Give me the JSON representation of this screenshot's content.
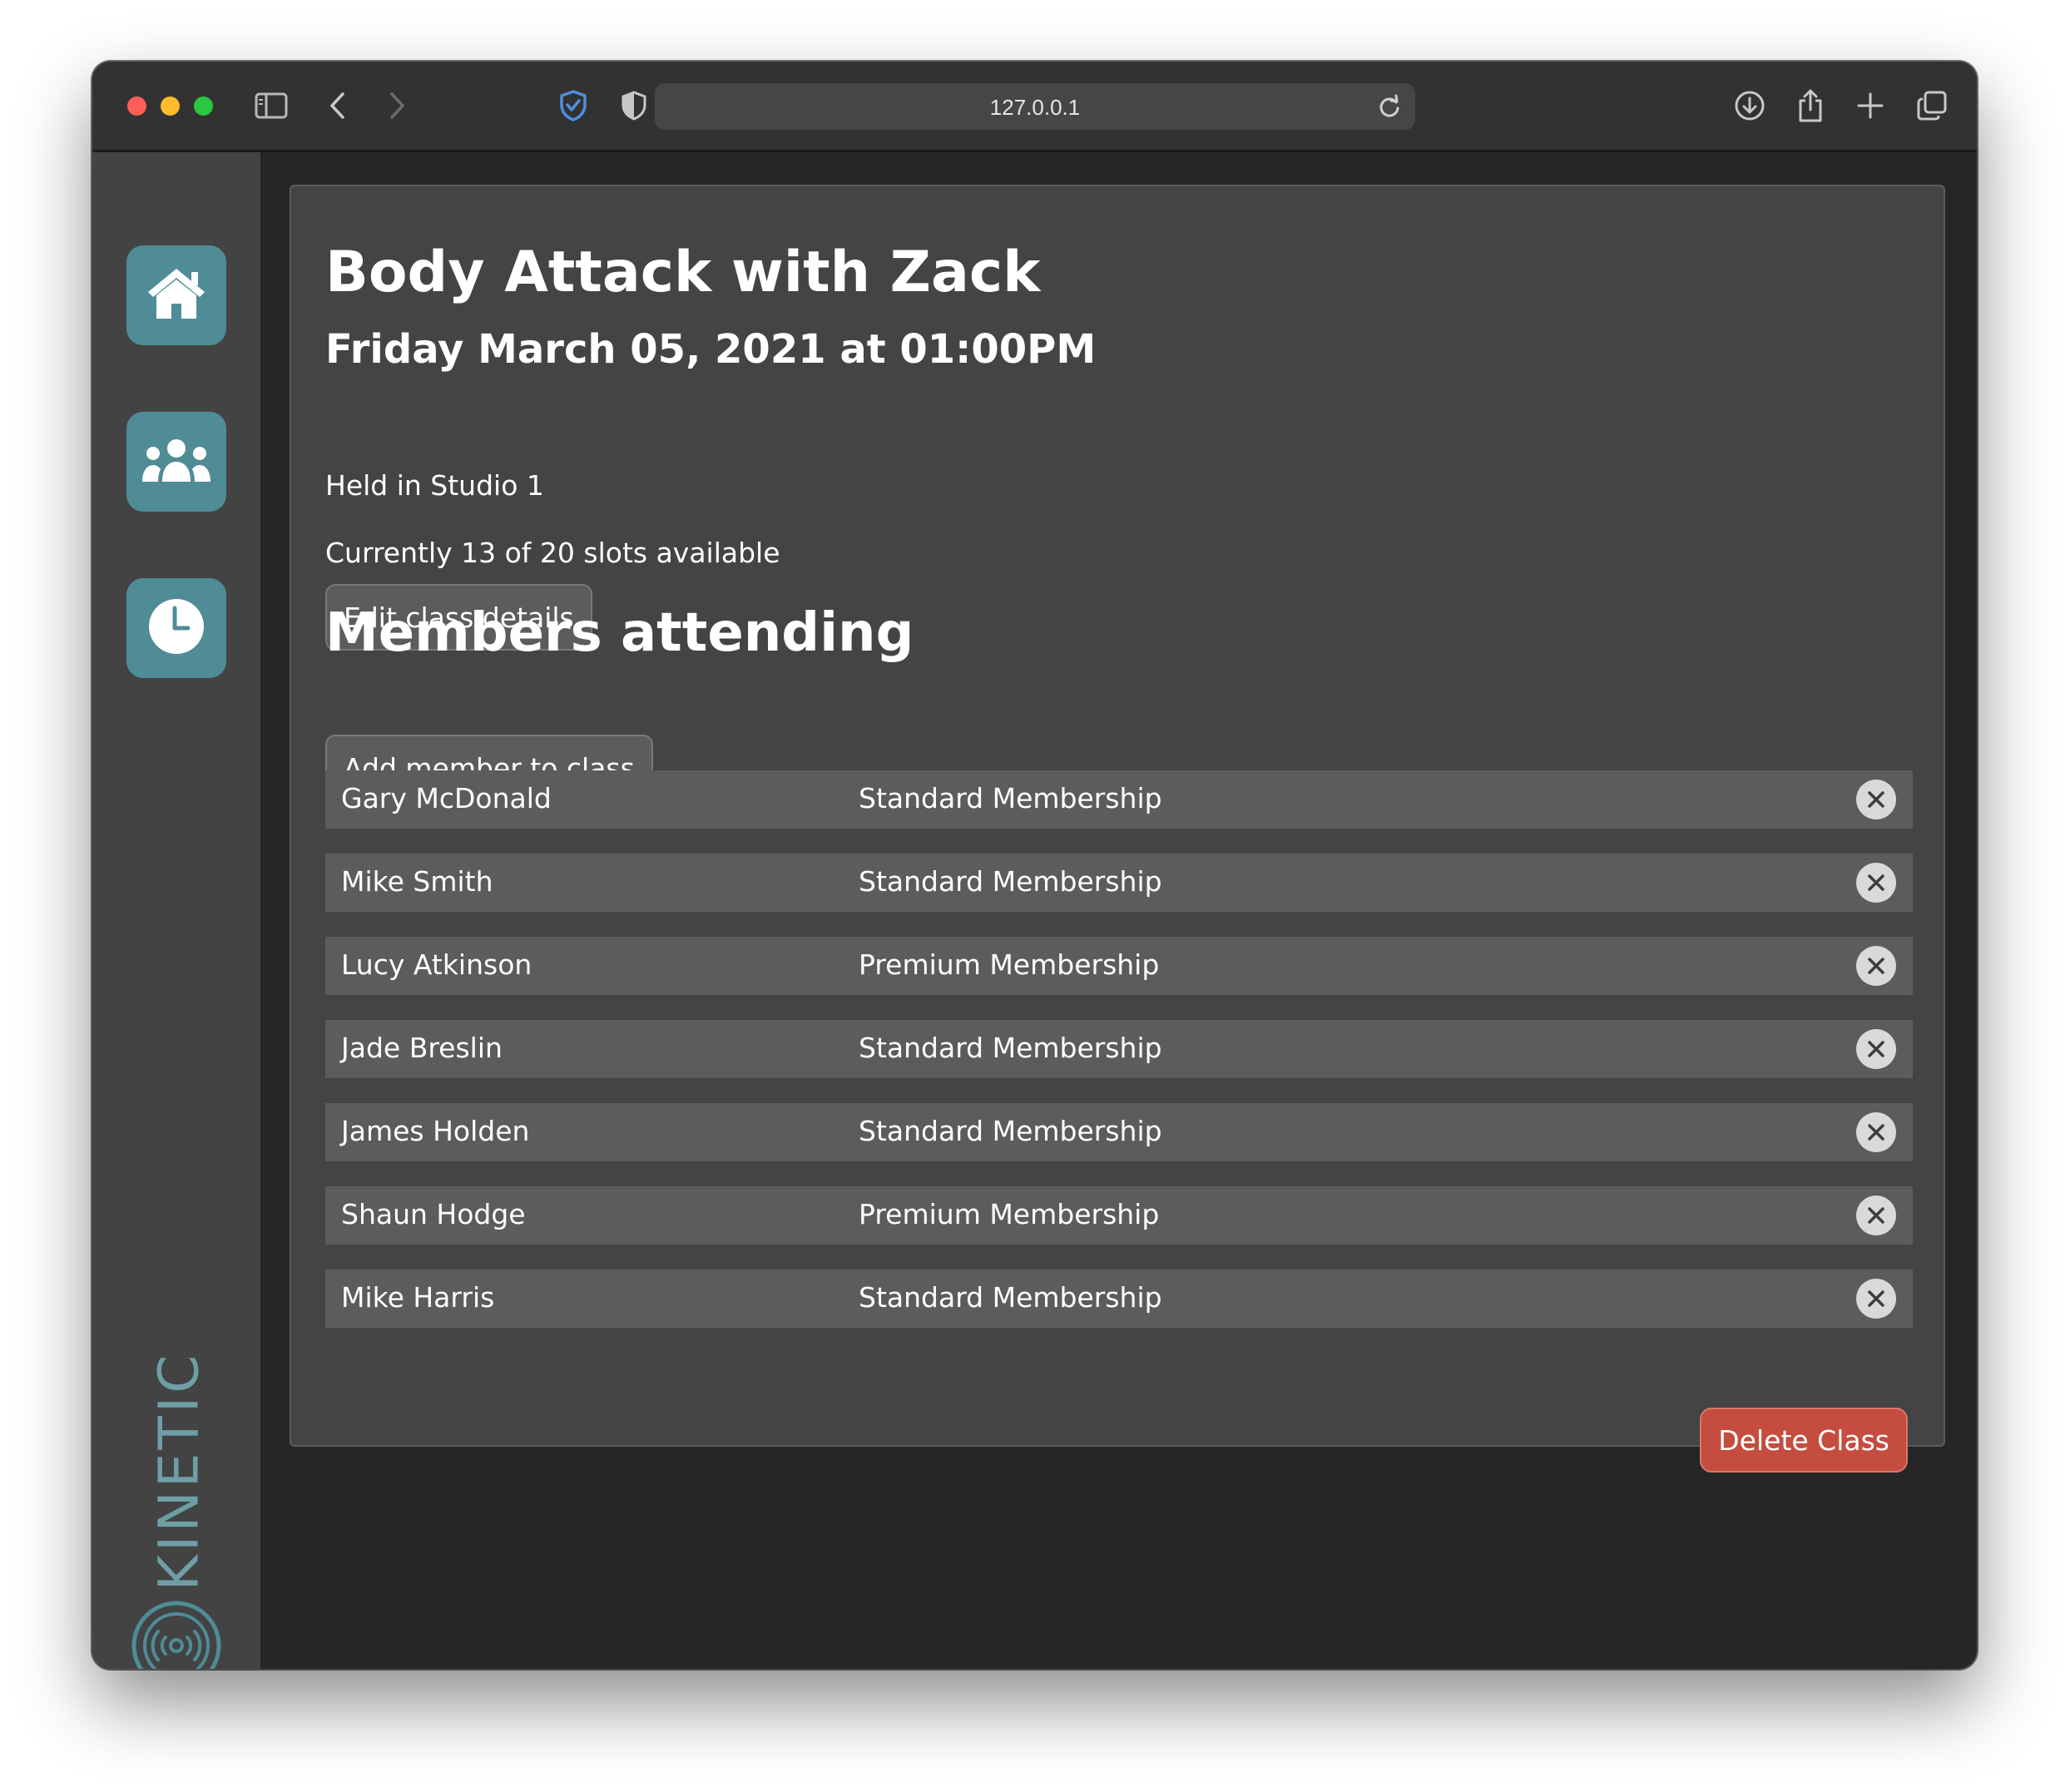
{
  "browser": {
    "url": "127.0.0.1",
    "traffic_colors": {
      "close": "#ff5f57",
      "minimize": "#febc2e",
      "zoom": "#28c840"
    }
  },
  "sidebar": {
    "brand": "KINETIC",
    "nav": [
      {
        "icon": "home-icon"
      },
      {
        "icon": "members-icon"
      },
      {
        "icon": "clock-icon"
      }
    ],
    "accent": "#4f8c96"
  },
  "class": {
    "title": "Body Attack with Zack",
    "datetime": "Friday March 05, 2021 at 01:00PM",
    "location": "Held in Studio 1",
    "availability": "Currently 13 of 20 slots available",
    "edit_label": "Edit class details"
  },
  "members_section": {
    "title": "Members attending",
    "add_label": "Add member to class",
    "members": [
      {
        "name": "Gary McDonald",
        "membership": "Standard Membership"
      },
      {
        "name": "Mike Smith",
        "membership": "Standard Membership"
      },
      {
        "name": "Lucy Atkinson",
        "membership": "Premium Membership"
      },
      {
        "name": "Jade Breslin",
        "membership": "Standard Membership"
      },
      {
        "name": "James Holden",
        "membership": "Standard Membership"
      },
      {
        "name": "Shaun Hodge",
        "membership": "Premium Membership"
      },
      {
        "name": "Mike Harris",
        "membership": "Standard Membership"
      }
    ]
  },
  "delete_label": "Delete Class",
  "delete_color": "#c44d3f"
}
